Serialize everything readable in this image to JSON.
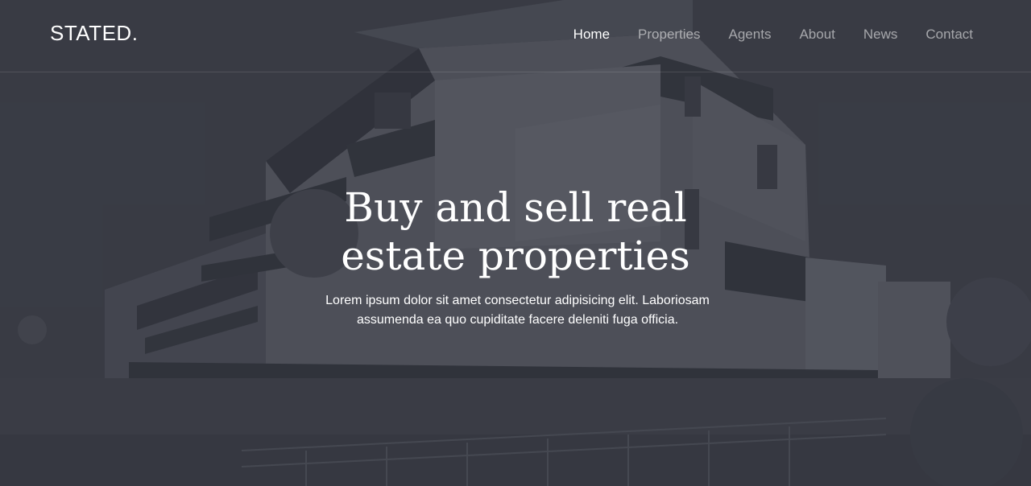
{
  "brand": {
    "logo": "STATED."
  },
  "nav": {
    "items": [
      {
        "label": "Home",
        "active": true
      },
      {
        "label": "Properties",
        "active": false
      },
      {
        "label": "Agents",
        "active": false
      },
      {
        "label": "About",
        "active": false
      },
      {
        "label": "News",
        "active": false
      },
      {
        "label": "Contact",
        "active": false
      }
    ]
  },
  "hero": {
    "headline_line1": "Buy and sell real",
    "headline_line2": "estate properties",
    "subtext_line1": "Lorem ipsum dolor sit amet consectetur adipisicing elit. Laboriosam",
    "subtext_line2": "assumenda ea quo cupiditate facere deleniti fuga officia."
  },
  "colors": {
    "overlay": "#343740",
    "text": "#ffffff",
    "nav_inactive": "#9a9ca3"
  }
}
